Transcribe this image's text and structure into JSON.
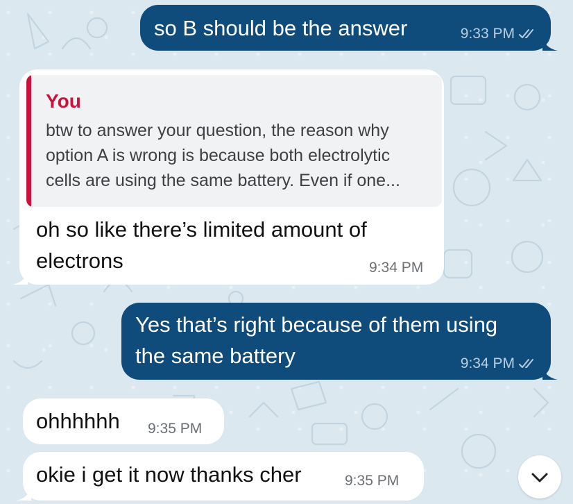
{
  "chat": {
    "messages": [
      {
        "direction": "outgoing",
        "text": "so B should be the answer",
        "time": "9:33 PM",
        "status_icon": "double-check-icon"
      },
      {
        "direction": "incoming",
        "reply_to": {
          "author": "You",
          "lines": [
            "btw to answer your question, the reason why",
            "option A is wrong is because both electrolytic",
            "cells are using the same battery. Even if one..."
          ]
        },
        "lines": [
          "oh so like there’s limited amount of",
          "electrons"
        ],
        "time": "9:34 PM"
      },
      {
        "direction": "outgoing",
        "lines": [
          "Yes that’s right because of them using",
          "the same battery"
        ],
        "time": "9:34 PM",
        "status_icon": "double-check-icon"
      },
      {
        "direction": "incoming",
        "text": "ohhhhhh",
        "time": "9:35 PM"
      },
      {
        "direction": "incoming",
        "text": "okie i get it now thanks cher",
        "time": "9:35 PM"
      }
    ]
  },
  "scroll_button": {
    "icon": "chevron-down-icon"
  },
  "colors": {
    "outgoing_bubble": "#0f4c7b",
    "incoming_bubble": "#ffffff",
    "reply_accent": "#c8143c",
    "background": "#dce8f0"
  }
}
